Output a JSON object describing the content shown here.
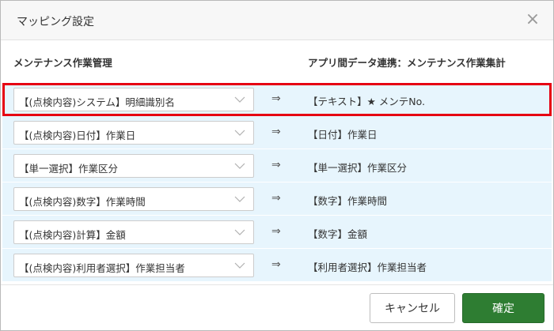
{
  "dialog": {
    "title": "マッピング設定",
    "close_label": "×"
  },
  "columns": {
    "left_header": "メンテナンス作業管理",
    "right_header": "アプリ間データ連携：メンテナンス作業集計"
  },
  "mapping_arrow": "⇒",
  "rows": [
    {
      "source": "【(点検内容)システム】明細識別名",
      "target": "【テキスト】★ メンテNo."
    },
    {
      "source": "【(点検内容)日付】作業日",
      "target": "【日付】作業日"
    },
    {
      "source": "【単一選択】作業区分",
      "target": "【単一選択】作業区分"
    },
    {
      "source": "【(点検内容)数字】作業時間",
      "target": "【数字】作業時間"
    },
    {
      "source": "【(点検内容)計算】金額",
      "target": "【数字】金額"
    },
    {
      "source": "【(点検内容)利用者選択】作業担当者",
      "target": "【利用者選択】作業担当者"
    }
  ],
  "footer": {
    "cancel_label": "キャンセル",
    "ok_label": "確定"
  },
  "colors": {
    "row_bg": "#e7f5fd",
    "highlight_border": "#e60012",
    "ok_button": "#2e7d32"
  }
}
